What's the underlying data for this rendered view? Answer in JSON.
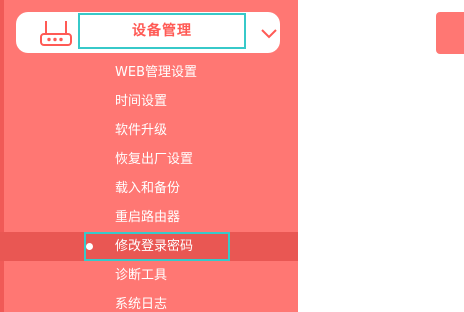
{
  "colors": {
    "sidebar_bg": "#ff7773",
    "accent": "#ff5a55",
    "active_bg": "#e95753",
    "highlight_border": "#37c9c9",
    "text_on_sidebar": "#ffffff"
  },
  "group": {
    "title": "设备管理",
    "icon": "router-icon",
    "expand_icon": "chevron-down-icon"
  },
  "menu": {
    "items": [
      {
        "label": "WEB管理设置",
        "active": false
      },
      {
        "label": "时间设置",
        "active": false
      },
      {
        "label": "软件升级",
        "active": false
      },
      {
        "label": "恢复出厂设置",
        "active": false
      },
      {
        "label": "载入和备份",
        "active": false
      },
      {
        "label": "重启路由器",
        "active": false
      },
      {
        "label": "修改登录密码",
        "active": true
      },
      {
        "label": "诊断工具",
        "active": false
      },
      {
        "label": "系统日志",
        "active": false
      }
    ]
  }
}
